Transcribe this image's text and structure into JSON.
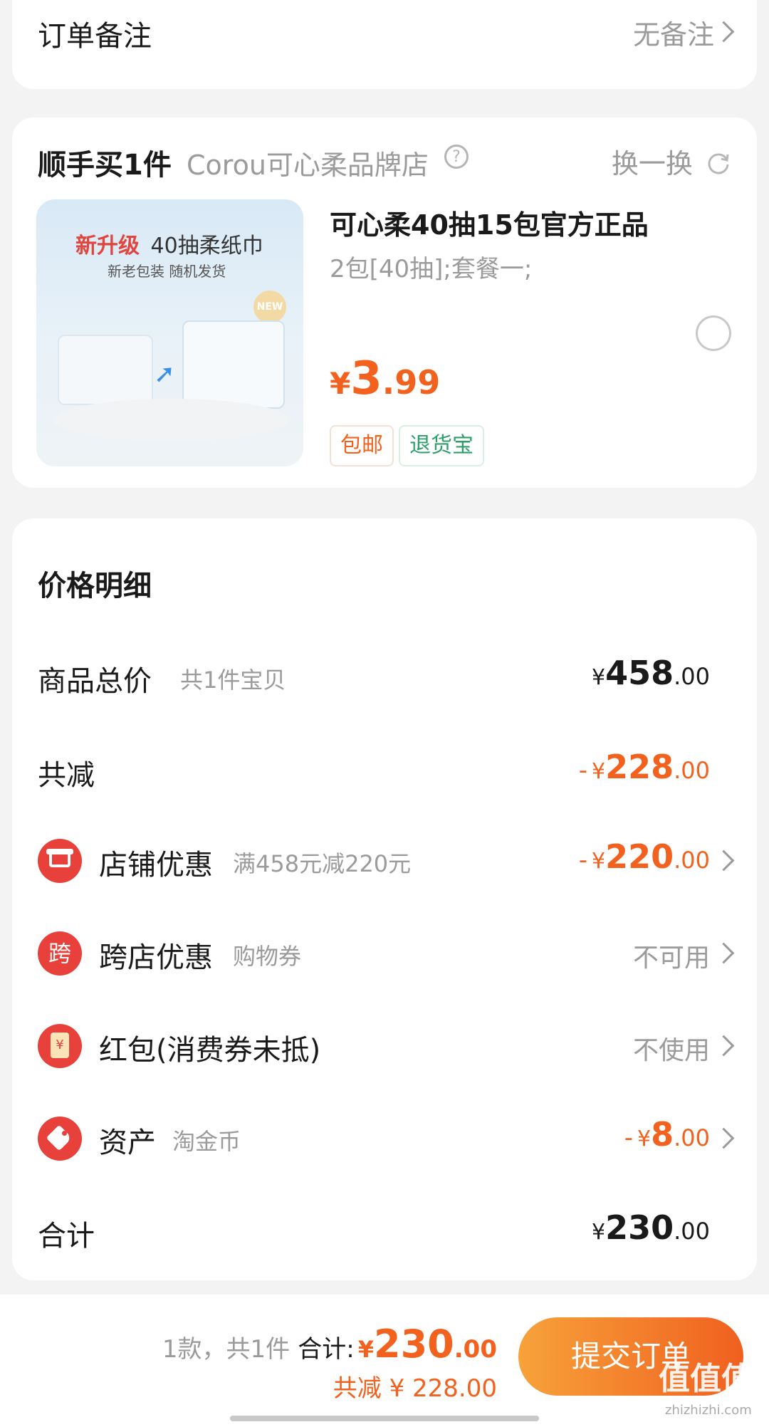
{
  "remark": {
    "label": "订单备注",
    "value": "无备注"
  },
  "addon": {
    "title": "顺手买1件",
    "shop": "Corou可心柔品牌店",
    "switch_label": "换一换",
    "product": {
      "image_headline": "新升级",
      "image_headline2": "40抽柔纸巾",
      "image_sub": "新老包装 随机发货",
      "image_badge": "NEW",
      "name": "可心柔40抽15包官方正品",
      "spec": "2包[40抽];套餐一;",
      "currency": "¥",
      "price_int": "3",
      "price_dec": ".99",
      "tags": [
        "包邮",
        "退货宝"
      ]
    }
  },
  "price_detail": {
    "title": "价格明细",
    "rows": {
      "goods_total": {
        "label": "商品总价",
        "sub": "共1件宝贝",
        "currency": "¥",
        "int": "458",
        "dec": ".00"
      },
      "total_off": {
        "label": "共减",
        "prefix": "-",
        "currency": "¥",
        "int": "228",
        "dec": ".00"
      },
      "shop_discount": {
        "label": "店铺优惠",
        "sub": "满458元减220元",
        "prefix": "-",
        "currency": "¥",
        "int": "220",
        "dec": ".00"
      },
      "cross_shop": {
        "label": "跨店优惠",
        "sub": "购物券",
        "icon_char": "跨",
        "value": "不可用"
      },
      "red_packet": {
        "label": "红包(消费券未抵)",
        "icon_char": "¥",
        "value": "不使用"
      },
      "assets": {
        "label": "资产",
        "sub": "淘金币",
        "prefix": "-",
        "currency": "¥",
        "int": "8",
        "dec": ".00"
      },
      "total": {
        "label": "合计",
        "currency": "¥",
        "int": "230",
        "dec": ".00"
      }
    }
  },
  "footer": {
    "count_text": "1款，共1件",
    "total_label": "合计:",
    "currency": "¥",
    "int": "230",
    "dec": ".00",
    "saved_text": "共减 ¥ 228.00",
    "submit_label": "提交订单",
    "watermark_main": "值值值",
    "watermark_url": "zhizhizhi.com"
  },
  "colors": {
    "accent": "#f2611d",
    "red": "#e8403a",
    "tag_green": "#2e9e6a"
  }
}
